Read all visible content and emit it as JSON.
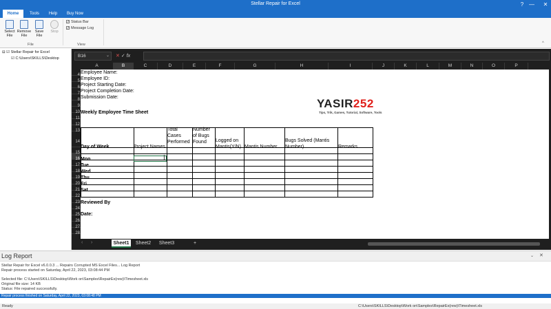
{
  "window": {
    "title": "Stellar Repair for Excel"
  },
  "menu": {
    "tabs": [
      "Home",
      "Tools",
      "Help",
      "Buy Now"
    ]
  },
  "ribbon": {
    "buttons": [
      "Select\nFile",
      "Remove\nFile",
      "Save\nFile",
      "Stop"
    ],
    "file_group_label": "File",
    "view_group_label": "View",
    "checkboxes": [
      "Status Bar",
      "Message Log"
    ]
  },
  "tree": {
    "root": "Stellar Repair for Excel",
    "child": "C:\\Users\\SKILLS\\Desktop"
  },
  "excel": {
    "name_box": "B16",
    "columns": [
      "A",
      "B",
      "C",
      "D",
      "E",
      "F",
      "G",
      "H",
      "I",
      "J",
      "K",
      "L",
      "M",
      "N",
      "O",
      "P"
    ],
    "rows": [
      "4",
      "5",
      "6",
      "7",
      "8",
      "9",
      "10",
      "11",
      "12",
      "13",
      "14",
      "15",
      "16",
      "17",
      "18",
      "19",
      "20",
      "21",
      "22",
      "23",
      "24",
      "25",
      "26",
      "27",
      "28"
    ],
    "fields": {
      "employee_name": "Employee Name:",
      "employee_id": "Employee ID:",
      "project_start": "Project Starting Date:",
      "project_completion": "Project Completion Date:",
      "submission": "Submission Date:",
      "sheet_title": "Weekly Employee Time Sheet",
      "reviewed_by": "Reviewed By",
      "date": "Date:"
    },
    "table_headers": {
      "day_of_week": "Day of Week",
      "project_names": "Project Names",
      "total_cases": "Total Cases Performed",
      "number_of_bugs": "Number of Bugs Found",
      "logged_on_mantis": "Logged on Mantis(Y/N)",
      "mantis_number": "Mantis Number",
      "bugs_solved": "Bugs Solved (Mantis Number)",
      "remarks": "Remarks"
    },
    "days": [
      "Mon",
      "Tue",
      "Wed",
      "Thu",
      "Fri",
      "Sat"
    ],
    "sheet_tabs": [
      "Sheet1",
      "Sheet2",
      "Sheet3"
    ],
    "add_sheet": "+"
  },
  "logo": {
    "text_dark": "YASIR",
    "text_red": "252",
    "tagline": "Tips, Trik, Games, Tutorial, Software, Tools"
  },
  "log": {
    "title": "Log Report",
    "lines": [
      "Stellar Repair for Excel v6.0.0.3 ... Repairs Corrupted MS Excel Files... Log Report",
      "Repair process started on  Saturday, April 22, 2023, 03:08:44 PM",
      "",
      "Selected file: C:\\Users\\SKILLS\\Desktop\\Work on\\Samples\\RepairEx(rew)\\Timesheet.xls",
      "Original file size: 14 KB",
      "Status: File repaired successfully."
    ],
    "finished": "Repair process finished on Saturday, April 22, 2023, 03:08:48 PM"
  },
  "status": {
    "left": "Ready",
    "path": "C:\\Users\\SKILLS\\Desktop\\Work on\\Samples\\RepairEx(rew)\\Timesheet.xls"
  }
}
